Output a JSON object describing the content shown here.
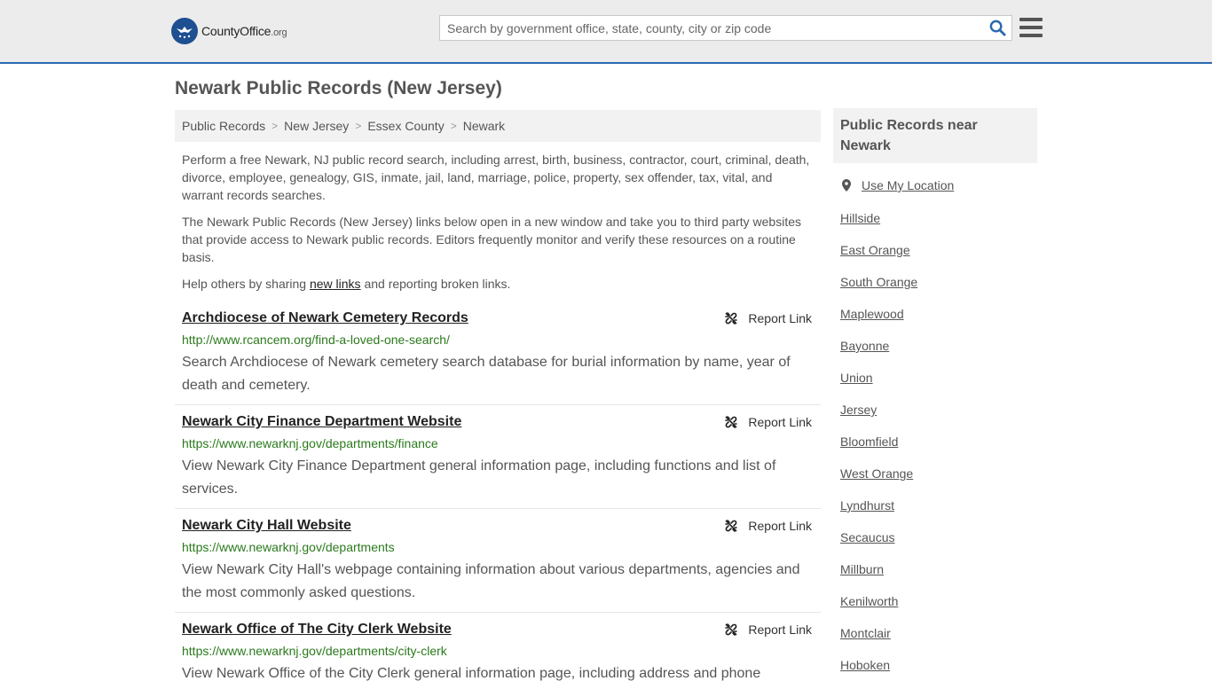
{
  "header": {
    "logo": {
      "brand": "CountyOffice",
      "tld": ".org"
    },
    "search": {
      "placeholder": "Search by government office, state, county, city or zip code"
    }
  },
  "page_title": "Newark Public Records (New Jersey)",
  "breadcrumb": [
    "Public Records",
    "New Jersey",
    "Essex County",
    "Newark"
  ],
  "intro": {
    "p1": "Perform a free Newark, NJ public record search, including arrest, birth, business, contractor, court, criminal, death, divorce, employee, genealogy, GIS, inmate, jail, land, marriage, police, property, sex offender, tax, vital, and warrant records searches.",
    "p2": "The Newark Public Records (New Jersey) links below open in a new window and take you to third party websites that provide access to Newark public records. Editors frequently monitor and verify these resources on a routine basis.",
    "p3_before": "Help others by sharing ",
    "p3_link": "new links",
    "p3_after": " and reporting broken links."
  },
  "report_label": "Report Link",
  "records": [
    {
      "title": "Archdiocese of Newark Cemetery Records",
      "url": "http://www.rcancem.org/find-a-loved-one-search/",
      "desc": "Search Archdiocese of Newark cemetery search database for burial information by name, year of death and cemetery."
    },
    {
      "title": "Newark City Finance Department Website",
      "url": "https://www.newarknj.gov/departments/finance",
      "desc": "View Newark City Finance Department general information page, including functions and list of services."
    },
    {
      "title": "Newark City Hall Website",
      "url": "https://www.newarknj.gov/departments",
      "desc": "View Newark City Hall's webpage containing information about various departments, agencies and the most commonly asked questions."
    },
    {
      "title": "Newark Office of The City Clerk Website",
      "url": "https://www.newarknj.gov/departments/city-clerk",
      "desc": "View Newark Office of the City Clerk general information page, including address and phone"
    }
  ],
  "sidebar": {
    "heading": "Public Records near Newark",
    "use_location": "Use My Location",
    "links": [
      "Hillside",
      "East Orange",
      "South Orange",
      "Maplewood",
      "Bayonne",
      "Union",
      "Jersey",
      "Bloomfield",
      "West Orange",
      "Lyndhurst",
      "Secaucus",
      "Millburn",
      "Kenilworth",
      "Montclair",
      "Hoboken"
    ]
  },
  "colors": {
    "accent": "#2a6ab1",
    "url_green": "#2b7a1c",
    "logo_blue": "#1d4f91"
  }
}
